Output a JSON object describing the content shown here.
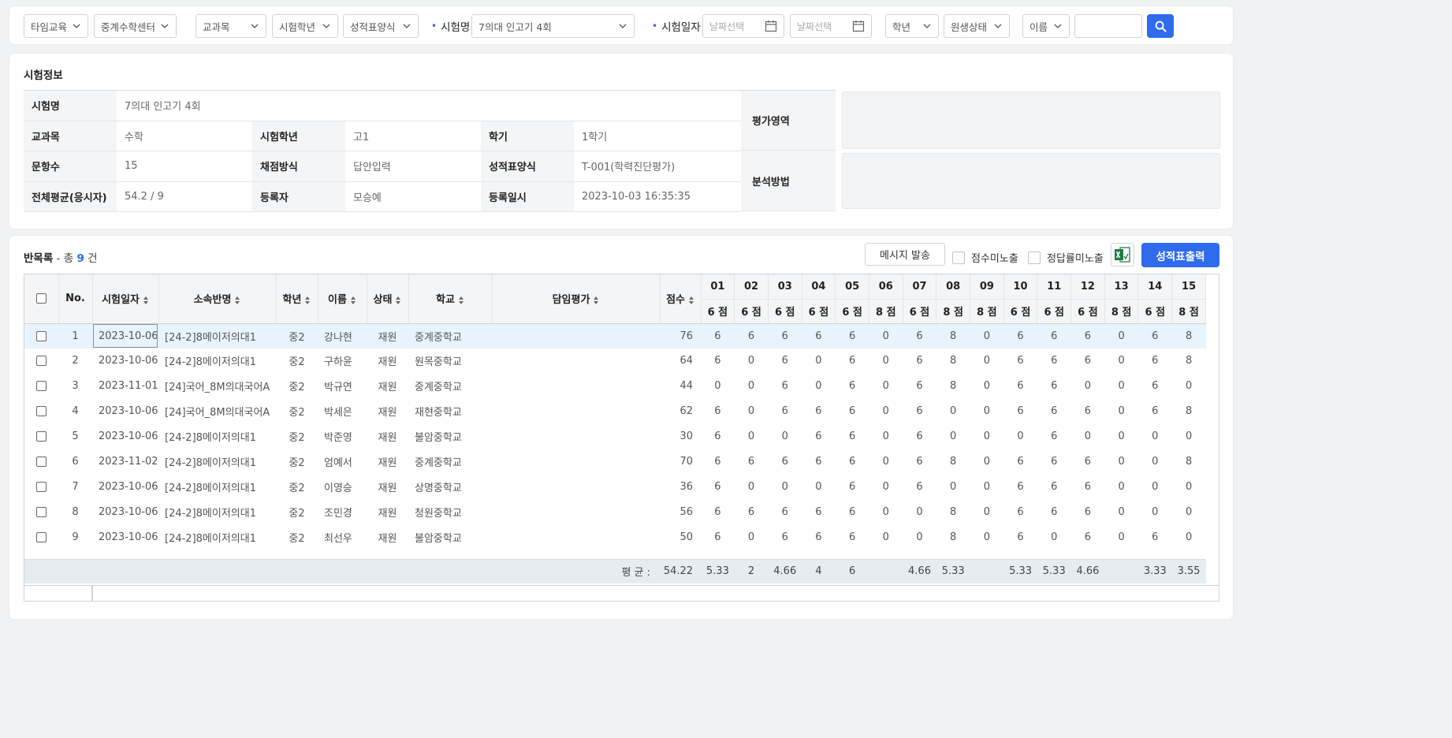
{
  "filters": {
    "org": "타임교육",
    "center": "중계수학센터",
    "subject": "교과목",
    "grade": "시험학년",
    "format": "성적표양식",
    "exam_name_label": "시험명",
    "exam_name_value": "7의대 인고기 4회",
    "exam_date_label": "시험일자",
    "date_from_placeholder": "날짜선택",
    "date_to_placeholder": "날짜선택",
    "student_grade": "학년",
    "student_status": "원생상태",
    "name_field": "이름",
    "name_value": ""
  },
  "info": {
    "title": "시험정보",
    "rows": [
      [
        {
          "l": "시험명",
          "v": "7의대 인고기 4회"
        }
      ],
      [
        {
          "l": "교과목",
          "v": "수학"
        },
        {
          "l": "시험학년",
          "v": "고1"
        },
        {
          "l": "학기",
          "v": "1학기"
        }
      ],
      [
        {
          "l": "문항수",
          "v": "15"
        },
        {
          "l": "채점방식",
          "v": "답안입력"
        },
        {
          "l": "성적표양식",
          "v": "T-001(학력진단평가)"
        }
      ],
      [
        {
          "l": "전체평균(응시자)",
          "v": "54.2 / 9"
        },
        {
          "l": "등록자",
          "v": "모승예"
        },
        {
          "l": "등록일시",
          "v": "2023-10-03 16:35:35"
        }
      ]
    ],
    "eval_area_label": "평가영역",
    "analysis_label": "분석방법"
  },
  "list": {
    "title": "반목록",
    "count_prefix": " - 총 ",
    "count": "9",
    "count_suffix": " 건",
    "message_button": "메시지 발송",
    "hide_score_label": "점수미노출",
    "hide_rate_label": "정답률미노출",
    "print_button": "성적표출력",
    "columns": {
      "no": "No.",
      "date": "시험일자",
      "class": "소속반명",
      "grade": "학년",
      "name": "이름",
      "status": "상태",
      "school": "학교",
      "eval": "담임평가",
      "score": "점수"
    },
    "questions": [
      {
        "no": "01",
        "pts": "6 점"
      },
      {
        "no": "02",
        "pts": "6 점"
      },
      {
        "no": "03",
        "pts": "6 점"
      },
      {
        "no": "04",
        "pts": "6 점"
      },
      {
        "no": "05",
        "pts": "6 점"
      },
      {
        "no": "06",
        "pts": "8 점"
      },
      {
        "no": "07",
        "pts": "6 점"
      },
      {
        "no": "08",
        "pts": "8 점"
      },
      {
        "no": "09",
        "pts": "8 점"
      },
      {
        "no": "10",
        "pts": "6 점"
      },
      {
        "no": "11",
        "pts": "6 점"
      },
      {
        "no": "12",
        "pts": "6 점"
      },
      {
        "no": "13",
        "pts": "8 점"
      },
      {
        "no": "14",
        "pts": "6 점"
      },
      {
        "no": "15",
        "pts": "8 점"
      }
    ],
    "rows": [
      {
        "no": "1",
        "date": "2023-10-06",
        "class": "[24-2]8메이저의대1",
        "grade": "중2",
        "name": "강나현",
        "status": "재원",
        "school": "중계중학교",
        "eval": "",
        "score": "76",
        "q": [
          "6",
          "6",
          "6",
          "6",
          "6",
          "0",
          "6",
          "8",
          "0",
          "6",
          "6",
          "6",
          "0",
          "6",
          "8"
        ]
      },
      {
        "no": "2",
        "date": "2023-10-06",
        "class": "[24-2]8메이저의대1",
        "grade": "중2",
        "name": "구하윤",
        "status": "재원",
        "school": "원목중학교",
        "eval": "",
        "score": "64",
        "q": [
          "6",
          "0",
          "6",
          "0",
          "6",
          "0",
          "6",
          "8",
          "0",
          "6",
          "6",
          "6",
          "0",
          "6",
          "8"
        ]
      },
      {
        "no": "3",
        "date": "2023-11-01",
        "class": "[24]국어_8M의대국어A",
        "grade": "중2",
        "name": "박규연",
        "status": "재원",
        "school": "중계중학교",
        "eval": "",
        "score": "44",
        "q": [
          "0",
          "0",
          "6",
          "0",
          "6",
          "0",
          "6",
          "8",
          "0",
          "6",
          "6",
          "0",
          "0",
          "6",
          "0"
        ]
      },
      {
        "no": "4",
        "date": "2023-10-06",
        "class": "[24]국어_8M의대국어A",
        "grade": "중2",
        "name": "박세은",
        "status": "재원",
        "school": "재현중학교",
        "eval": "",
        "score": "62",
        "q": [
          "6",
          "0",
          "6",
          "6",
          "6",
          "0",
          "6",
          "0",
          "0",
          "6",
          "6",
          "6",
          "0",
          "6",
          "8"
        ]
      },
      {
        "no": "5",
        "date": "2023-10-06",
        "class": "[24-2]8메이저의대1",
        "grade": "중2",
        "name": "박준영",
        "status": "재원",
        "school": "불암중학교",
        "eval": "",
        "score": "30",
        "q": [
          "6",
          "0",
          "0",
          "6",
          "6",
          "0",
          "6",
          "0",
          "0",
          "0",
          "6",
          "0",
          "0",
          "0",
          "0"
        ]
      },
      {
        "no": "6",
        "date": "2023-11-02",
        "class": "[24-2]8메이저의대1",
        "grade": "중2",
        "name": "엄예서",
        "status": "재원",
        "school": "중계중학교",
        "eval": "",
        "score": "70",
        "q": [
          "6",
          "6",
          "6",
          "6",
          "6",
          "0",
          "6",
          "8",
          "0",
          "6",
          "6",
          "6",
          "0",
          "0",
          "8"
        ]
      },
      {
        "no": "7",
        "date": "2023-10-06",
        "class": "[24-2]8메이저의대1",
        "grade": "중2",
        "name": "이영승",
        "status": "재원",
        "school": "상명중학교",
        "eval": "",
        "score": "36",
        "q": [
          "6",
          "0",
          "0",
          "0",
          "6",
          "0",
          "6",
          "0",
          "0",
          "6",
          "6",
          "6",
          "0",
          "0",
          "0"
        ]
      },
      {
        "no": "8",
        "date": "2023-10-06",
        "class": "[24-2]8메이저의대1",
        "grade": "중2",
        "name": "조민경",
        "status": "재원",
        "school": "청원중학교",
        "eval": "",
        "score": "56",
        "q": [
          "6",
          "6",
          "6",
          "6",
          "6",
          "0",
          "0",
          "8",
          "0",
          "6",
          "6",
          "6",
          "0",
          "0",
          "0"
        ]
      },
      {
        "no": "9",
        "date": "2023-10-06",
        "class": "[24-2]8메이저의대1",
        "grade": "중2",
        "name": "최선우",
        "status": "재원",
        "school": "불암중학교",
        "eval": "",
        "score": "50",
        "q": [
          "6",
          "0",
          "6",
          "6",
          "6",
          "0",
          "0",
          "8",
          "0",
          "6",
          "0",
          "6",
          "0",
          "6",
          "0"
        ]
      }
    ],
    "average": {
      "label": "평 균 :",
      "score": "54.22",
      "q": [
        "5.33",
        "2",
        "4.66",
        "4",
        "6",
        "",
        "4.66",
        "5.33",
        "",
        "5.33",
        "5.33",
        "4.66",
        "",
        "3.33",
        "3.55"
      ]
    }
  },
  "colors": {
    "accent": "#2f6bec",
    "selected_row": "#e7f4fd",
    "avg_row": "#e6edf0"
  }
}
